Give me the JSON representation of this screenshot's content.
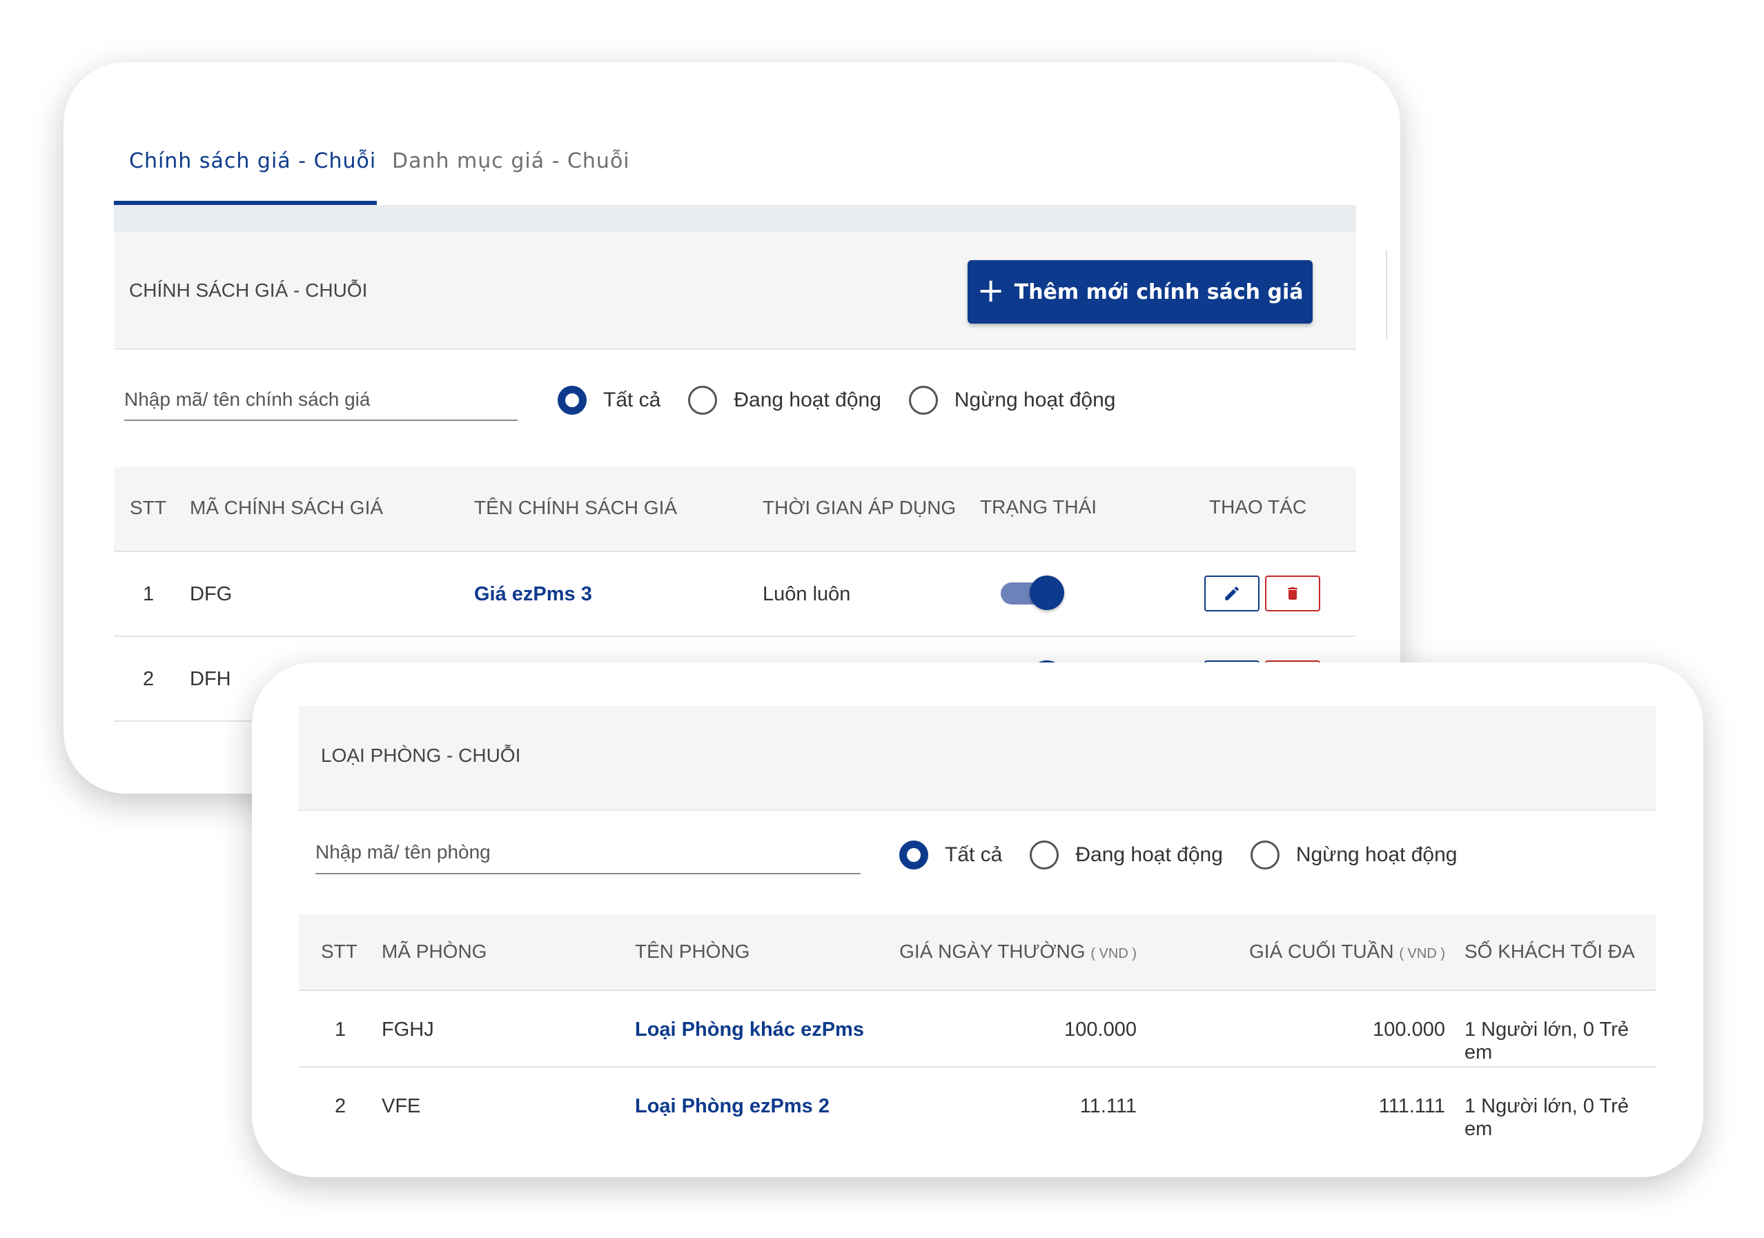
{
  "policy_card": {
    "tabs": [
      {
        "label": "Chính sách giá - Chuỗi",
        "active": true
      },
      {
        "label": "Danh mục giá - Chuỗi",
        "active": false
      }
    ],
    "section_title": "CHÍNH SÁCH GIÁ - CHUỖI",
    "add_button_label": "Thêm mới chính sách giá",
    "search_placeholder": "Nhập mã/ tên chính sách giá",
    "filters": [
      {
        "label": "Tất cả",
        "checked": true
      },
      {
        "label": "Đang hoạt động",
        "checked": false
      },
      {
        "label": "Ngừng hoạt động",
        "checked": false
      }
    ],
    "columns": [
      "STT",
      "MÃ CHÍNH SÁCH GIÁ",
      "TÊN CHÍNH SÁCH GIÁ",
      "THỜI GIAN ÁP DỤNG",
      "TRẠNG THÁI",
      "THAO TÁC"
    ],
    "rows": [
      {
        "stt": "1",
        "code": "DFG",
        "name": "Giá ezPms 3",
        "period": "Luôn luôn",
        "active": true
      },
      {
        "stt": "2",
        "code": "DFH",
        "name": "",
        "period": "",
        "active": true
      }
    ]
  },
  "room_card": {
    "section_title": "LOẠI PHÒNG - CHUỖI",
    "search_placeholder": "Nhập mã/ tên phòng",
    "filters": [
      {
        "label": "Tất cả",
        "checked": true
      },
      {
        "label": "Đang hoạt động",
        "checked": false
      },
      {
        "label": "Ngừng hoạt động",
        "checked": false
      }
    ],
    "columns": {
      "stt": "STT",
      "code": "MÃ PHÒNG",
      "name": "TÊN PHÒNG",
      "weekday_price": "GIÁ NGÀY THƯỜNG",
      "weekend_price": "GIÁ CUỐI TUẦN",
      "unit": "( VND )",
      "max_guests": "SỐ KHÁCH TỐI ĐA"
    },
    "rows": [
      {
        "stt": "1",
        "code": "FGHJ",
        "name": "Loại Phòng khác ezPms",
        "weekday": "100.000",
        "weekend": "100.000",
        "guests": "1 Người lớn, 0 Trẻ em"
      },
      {
        "stt": "2",
        "code": "VFE",
        "name": "Loại Phòng ezPms 2",
        "weekday": "11.111",
        "weekend": "111.111",
        "guests": "1 Người lớn, 0 Trẻ em"
      }
    ]
  },
  "colors": {
    "primary": "#0d3a8c",
    "danger": "#c62828",
    "header_bg": "#f5f5f5"
  }
}
